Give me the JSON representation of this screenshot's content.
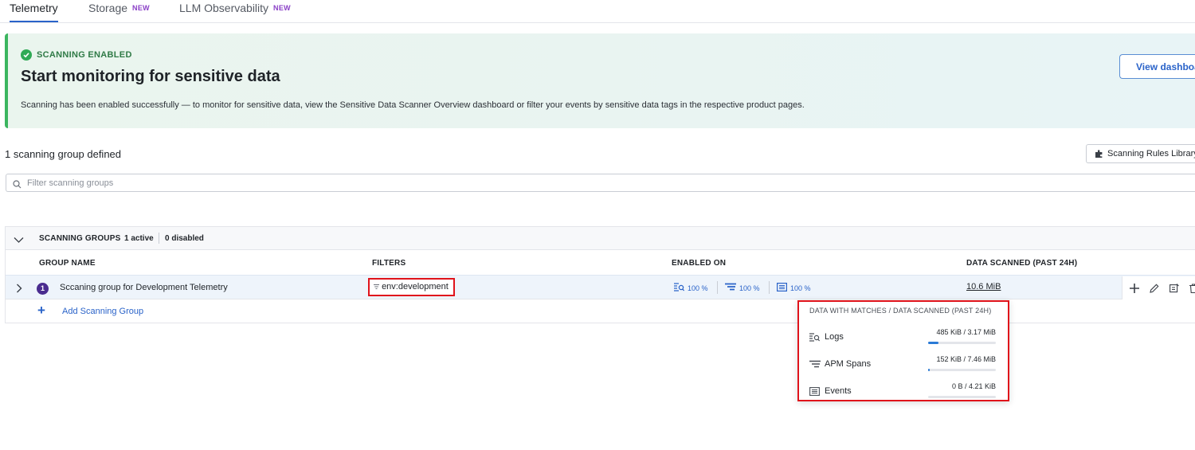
{
  "tabs": [
    {
      "label": "Telemetry",
      "badge": ""
    },
    {
      "label": "Storage",
      "badge": "NEW"
    },
    {
      "label": "LLM Observability",
      "badge": "NEW"
    }
  ],
  "banner": {
    "status": "SCANNING ENABLED",
    "title": "Start monitoring for sensitive data",
    "description": "Scanning has been enabled successfully — to monitor for sensitive data, view the Sensitive Data Scanner Overview dashboard or filter your events by sensitive data tags in the respective product pages.",
    "button_label": "View dashboard"
  },
  "groups_summary": "1 scanning group defined",
  "library_button": "Scanning Rules Library",
  "search": {
    "placeholder": "Filter scanning groups"
  },
  "section": {
    "label": "SCANNING GROUPS",
    "active": "1 active",
    "disabled": "0 disabled"
  },
  "columns": [
    "GROUP NAME",
    "FILTERS",
    "ENABLED ON",
    "DATA SCANNED (PAST 24H)"
  ],
  "row": {
    "index": "1",
    "name": "Sccaning group for Development Telemetry",
    "filter": "env:development",
    "enabled_on": [
      {
        "icon": "logs-icon",
        "value": "100 %"
      },
      {
        "icon": "apm-spans-icon",
        "value": "100 %"
      },
      {
        "icon": "events-icon",
        "value": "100 %"
      }
    ],
    "data_scanned": "10.6 MiB"
  },
  "add_group_label": "Add Scanning Group",
  "popover": {
    "title": "DATA WITH MATCHES / DATA SCANNED (PAST 24H)",
    "items": [
      {
        "name": "Logs",
        "value": "485 KiB / 3.17 MiB",
        "fraction": 0.15
      },
      {
        "name": "APM Spans",
        "value": "152 KiB / 7.46 MiB",
        "fraction": 0.02
      },
      {
        "name": "Events",
        "value": "0 B / 4.21 KiB",
        "fraction": 0
      }
    ]
  },
  "colors": {
    "accent": "#2a63c9",
    "success": "#2faa55",
    "highlight": "#e0131b",
    "badge": "#8a3fc7"
  }
}
